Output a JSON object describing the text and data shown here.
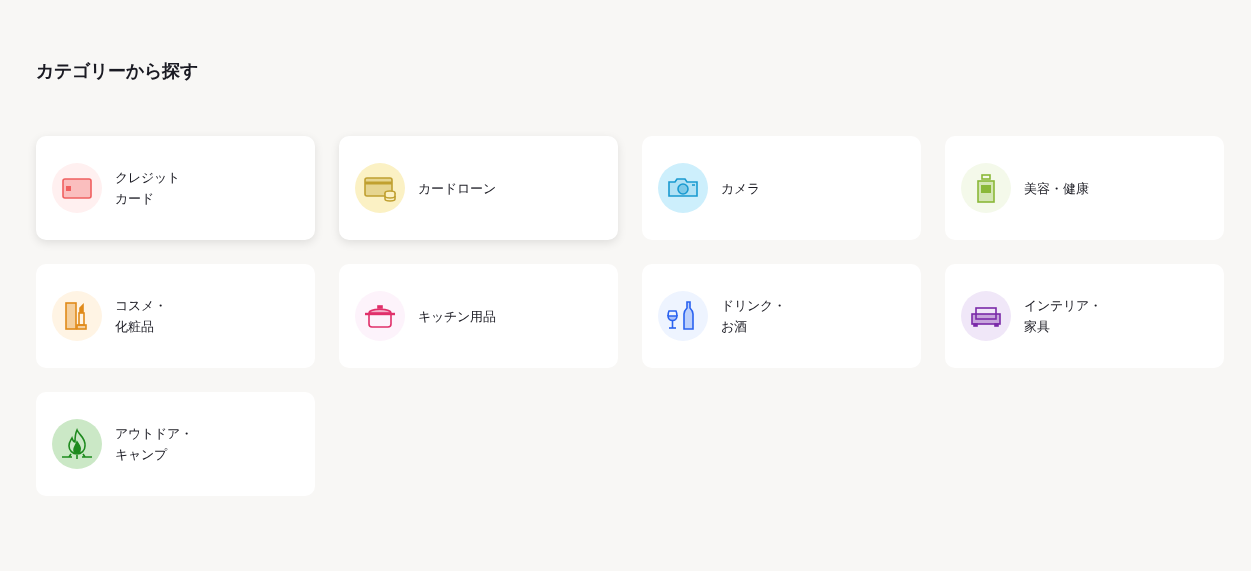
{
  "heading": "カテゴリーから探す",
  "categories": [
    {
      "kind": "card",
      "lines": [
        "クレジット",
        "カード"
      ],
      "raised": true
    },
    {
      "kind": "loan",
      "lines": [
        "カードローン"
      ],
      "raised": true
    },
    {
      "kind": "camera",
      "lines": [
        "カメラ"
      ],
      "raised": false
    },
    {
      "kind": "perfume",
      "lines": [
        "美容・健康"
      ],
      "raised": false
    },
    {
      "kind": "cosme",
      "lines": [
        "コスメ・",
        "化粧品"
      ],
      "raised": false
    },
    {
      "kind": "pot",
      "lines": [
        "キッチン用品"
      ],
      "raised": false
    },
    {
      "kind": "drink",
      "lines": [
        "ドリンク・",
        "お酒"
      ],
      "raised": false
    },
    {
      "kind": "sofa",
      "lines": [
        "インテリア・",
        "家具"
      ],
      "raised": false
    },
    {
      "kind": "fire",
      "lines": [
        "アウトドア・",
        "キャンプ"
      ],
      "raised": false
    }
  ]
}
